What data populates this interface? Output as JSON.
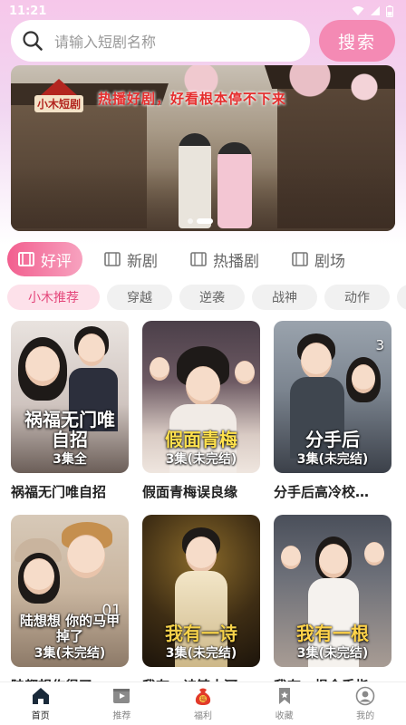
{
  "status_bar": {
    "time": "11:21"
  },
  "search": {
    "placeholder": "请输入短剧名称",
    "button_label": "搜索"
  },
  "banner": {
    "logo_text": "小木短剧",
    "slogan": "热播好剧，好看根本停不下来"
  },
  "category_tabs": [
    {
      "label": "好评",
      "active": true
    },
    {
      "label": "新剧",
      "active": false
    },
    {
      "label": "热播剧",
      "active": false
    },
    {
      "label": "剧场",
      "active": false
    }
  ],
  "tags": [
    {
      "label": "小木推荐",
      "active": true
    },
    {
      "label": "穿越",
      "active": false
    },
    {
      "label": "逆袭",
      "active": false
    },
    {
      "label": "战神",
      "active": false
    },
    {
      "label": "动作",
      "active": false
    }
  ],
  "dramas": [
    {
      "title": "祸福无门唯自招",
      "poster_text": "祸福无门唯自招",
      "episodes": "3集全"
    },
    {
      "title": "假面青梅误良缘",
      "poster_text": "假面青梅",
      "episodes": "3集(未完结)"
    },
    {
      "title": "分手后高冷校…",
      "poster_text": "分手后",
      "episodes": "3集(未完结)",
      "corner_number": "3"
    },
    {
      "title": "陆都想作很了",
      "poster_text": "陆想想 你的马甲掉了",
      "episodes": "3集(未完结)",
      "corner_number": "01"
    },
    {
      "title": "我有一诗镇大河",
      "poster_text": "我有一诗",
      "episodes": "3集(未完结)"
    },
    {
      "title": "我有一根金手指",
      "poster_text": "我有一根",
      "episodes": "3集(未完结)"
    }
  ],
  "bottom_nav": [
    {
      "label": "首页",
      "icon": "home-icon",
      "active": true
    },
    {
      "label": "推荐",
      "icon": "video-icon",
      "active": false
    },
    {
      "label": "福利",
      "icon": "lucky-bag-icon",
      "active": false
    },
    {
      "label": "收藏",
      "icon": "bookmark-icon",
      "active": false
    },
    {
      "label": "我的",
      "icon": "profile-icon",
      "active": false
    }
  ],
  "colors": {
    "accent": "#f25f8f",
    "search_button": "#f48ab4",
    "tag_active_bg": "#fde1ea"
  }
}
